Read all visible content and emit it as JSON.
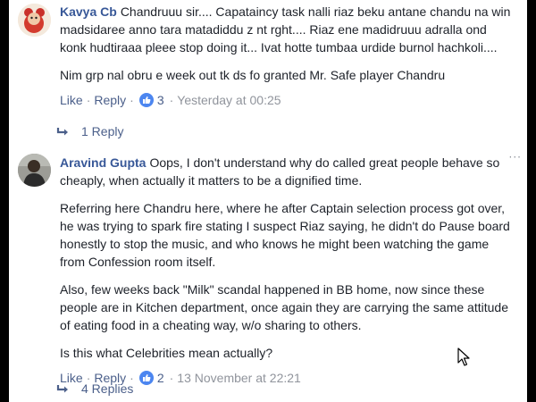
{
  "comments": [
    {
      "author": "Kavya Cb",
      "paragraphs": [
        "Chandruuu sir.... Capataincy task nalli riaz beku antane chandu na win madsidaree anno tara matadiddu z nt rght.... Riaz ene madidruuu adralla ond konk hudtiraaa pleee stop doing it... Ivat hotte tumbaa urdide burnol hachkoli....",
        "Nim grp nal obru e week out tk ds fo granted Mr. Safe player Chandru"
      ],
      "like_label": "Like",
      "reply_label": "Reply",
      "reaction_count": "3",
      "timestamp": "Yesterday at 00:25",
      "replies_label": "1 Reply"
    },
    {
      "author": "Aravind Gupta",
      "paragraphs": [
        "Oops, I don't understand why do called great people behave so cheaply, when actually it matters to be a dignified time.",
        "Referring here Chandru here, where he after Captain selection process got over, he was trying to spark fire stating I suspect Riaz saying, he didn't do Pause board honestly to stop the music, and who knows he might been watching the game from Confession room itself.",
        "Also, few weeks back \"Milk\" scandal happened in BB home, now since these people are in Kitchen department, once again they are carrying the same attitude of eating food in a cheating way, w/o sharing to others.",
        "Is this what Celebrities mean actually?"
      ],
      "like_label": "Like",
      "reply_label": "Reply",
      "reaction_count": "2",
      "timestamp": "13 November at 22:21",
      "replies_label": "4 Replies"
    }
  ],
  "icons": {
    "reaction": "thumbs-up-icon",
    "reply_arrow": "reply-arrow-icon",
    "more": "more-options-icon",
    "cursor": "mouse-cursor-icon"
  },
  "colors": {
    "author_link": "#385898",
    "action_link": "#4b5f8a",
    "muted": "#90949c",
    "like_bubble": "#4c86f0"
  }
}
